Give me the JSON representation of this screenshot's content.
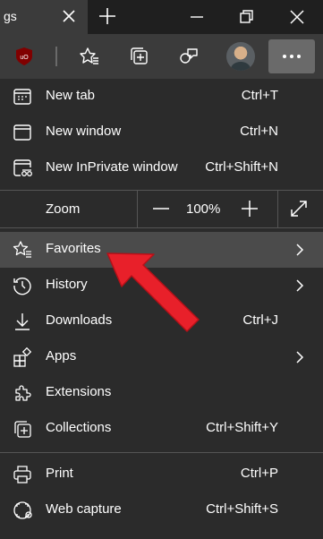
{
  "tab": {
    "title": "gs"
  },
  "menu": {
    "items": [
      {
        "label": "New tab",
        "shortcut": "Ctrl+T",
        "icon": "new-tab-icon"
      },
      {
        "label": "New window",
        "shortcut": "Ctrl+N",
        "icon": "window-icon"
      },
      {
        "label": "New InPrivate window",
        "shortcut": "Ctrl+Shift+N",
        "icon": "inprivate-icon"
      }
    ],
    "zoom": {
      "label": "Zoom",
      "value": "100%"
    },
    "items2": [
      {
        "label": "Favorites",
        "icon": "favorites-icon",
        "submenu": true,
        "highlighted": true
      },
      {
        "label": "History",
        "icon": "history-icon",
        "submenu": true
      },
      {
        "label": "Downloads",
        "shortcut": "Ctrl+J",
        "icon": "download-icon"
      },
      {
        "label": "Apps",
        "icon": "apps-icon",
        "submenu": true
      },
      {
        "label": "Extensions",
        "icon": "extensions-icon"
      },
      {
        "label": "Collections",
        "shortcut": "Ctrl+Shift+Y",
        "icon": "collections-icon"
      }
    ],
    "items3": [
      {
        "label": "Print",
        "shortcut": "Ctrl+P",
        "icon": "print-icon"
      },
      {
        "label": "Web capture",
        "shortcut": "Ctrl+Shift+S",
        "icon": "web-capture-icon"
      }
    ]
  },
  "colors": {
    "background": "#2b2b2b",
    "highlight": "#4b4b4b",
    "annotation_arrow": "#e8202a",
    "ublock": "#800000"
  }
}
